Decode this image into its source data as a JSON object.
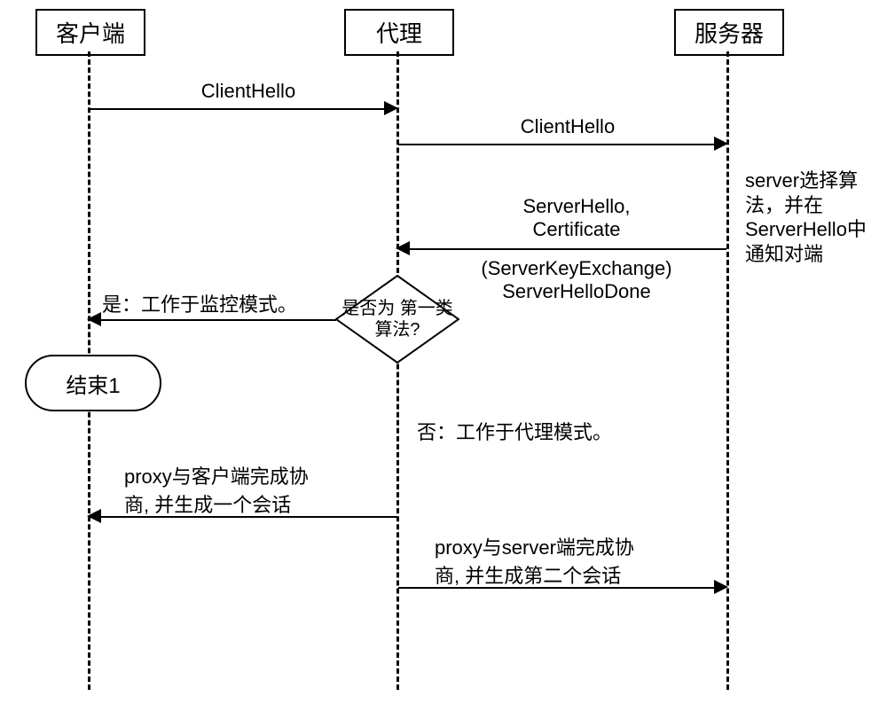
{
  "participants": {
    "client": "客户端",
    "proxy": "代理",
    "server": "服务器"
  },
  "messages": {
    "m1": "ClientHello",
    "m2": "ClientHello",
    "m3": "ServerHello,\nCertificate",
    "m3b": "(ServerKeyExchange)\nServerHelloDone",
    "decision": "是否为\n第一类算法?",
    "yes_label": "是：工作于监控模式。",
    "no_label": "否：工作于代理模式。",
    "m4": "proxy与客户端完成协\n商, 并生成一个会话",
    "m5": "proxy与server端完成协\n商, 并生成第二个会话"
  },
  "side_note": "server选择算\n法，并在\nServerHello中\n通知对端",
  "terminator": "结束1",
  "chart_data": {
    "type": "sequence-diagram",
    "participants": [
      "客户端",
      "代理",
      "服务器"
    ],
    "steps": [
      {
        "from": "客户端",
        "to": "代理",
        "label": "ClientHello"
      },
      {
        "from": "代理",
        "to": "服务器",
        "label": "ClientHello"
      },
      {
        "from": "服务器",
        "to": "代理",
        "label": "ServerHello, Certificate"
      },
      {
        "note_at": "服务器",
        "text": "server选择算法，并在ServerHello中通知对端"
      },
      {
        "from": "服务器",
        "to": "代理",
        "label": "(ServerKeyExchange) ServerHelloDone",
        "style": "continuation"
      },
      {
        "decision_at": "代理",
        "condition": "是否为第一类算法?",
        "yes": {
          "label": "是：工作于监控模式。",
          "to": "客户端",
          "end": "结束1"
        },
        "no": {
          "label": "否：工作于代理模式。"
        }
      },
      {
        "from": "代理",
        "to": "客户端",
        "label": "proxy与客户端完成协商, 并生成一个会话"
      },
      {
        "from": "代理",
        "to": "服务器",
        "label": "proxy与server端完成协商, 并生成第二个会话"
      }
    ]
  }
}
